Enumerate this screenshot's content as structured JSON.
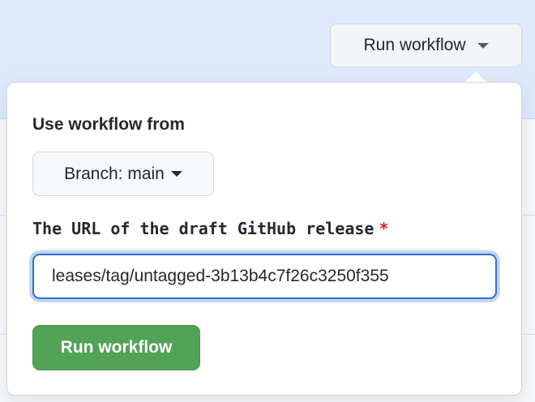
{
  "header": {
    "run_workflow_label": "Run workflow"
  },
  "popup": {
    "use_workflow_from_label": "Use workflow from",
    "branch_label": "Branch: main",
    "input_label": "The URL of the draft GitHub release",
    "required_marker": "*",
    "input_value": "leases/tag/untagged-3b13b4c7f26c3250f355",
    "submit_label": "Run workflow"
  },
  "colors": {
    "accent_green": "#53a356",
    "focus_blue": "#2f6fd8",
    "required_red": "#cf222e"
  }
}
